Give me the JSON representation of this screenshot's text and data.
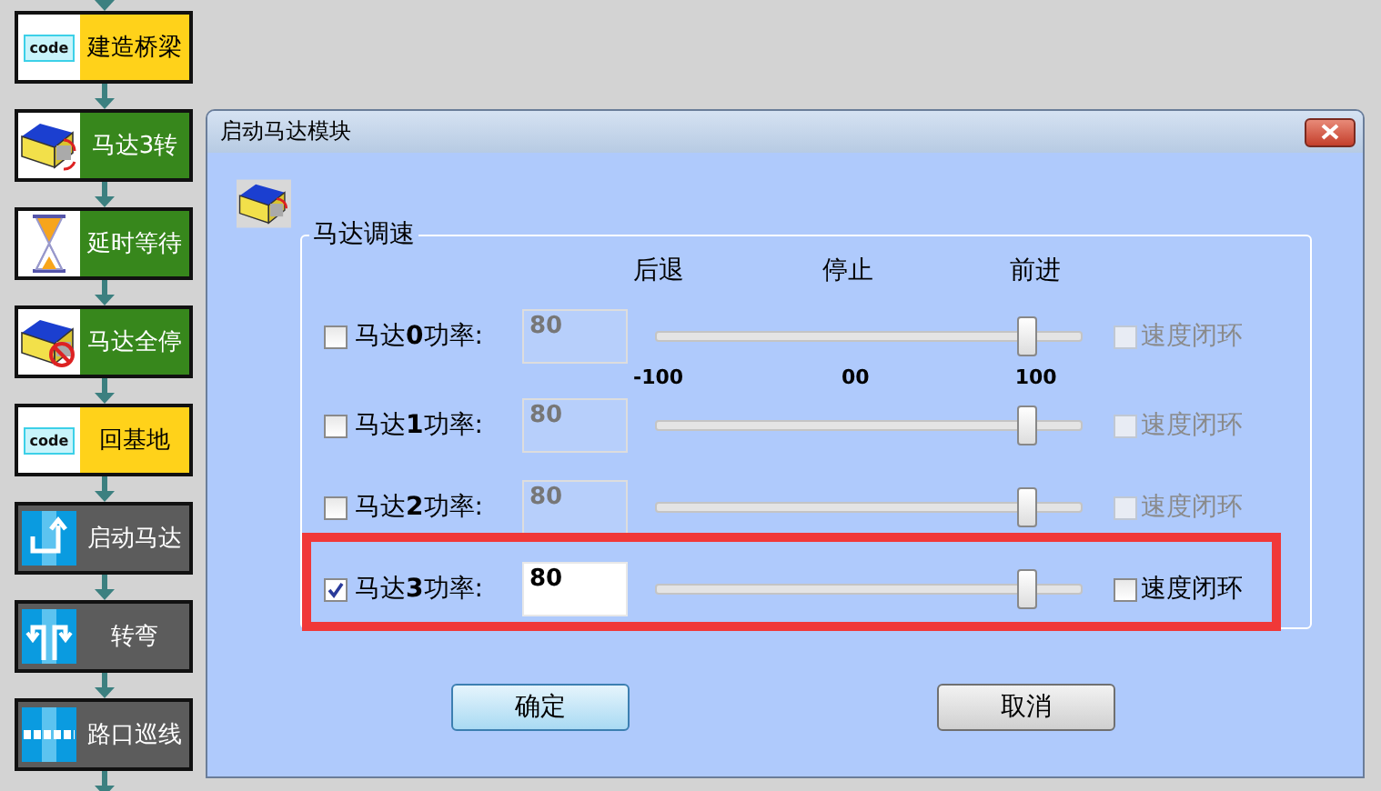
{
  "flow_blocks": [
    {
      "kind": "code",
      "icon_text": "code",
      "label": "建造桥梁",
      "color": "#ffd21a"
    },
    {
      "kind": "motor",
      "label": "马达3转",
      "color": "#37871c"
    },
    {
      "kind": "timer",
      "label": "延时等待",
      "color": "#37871c"
    },
    {
      "kind": "motor-stop",
      "label": "马达全停",
      "color": "#37871c"
    },
    {
      "kind": "code",
      "icon_text": "code",
      "label": "回基地",
      "color": "#ffd21a"
    },
    {
      "kind": "start",
      "label": "启动马达",
      "color": "#5c5c5c"
    },
    {
      "kind": "turn",
      "label": "转弯",
      "color": "#5c5c5c"
    },
    {
      "kind": "line",
      "label": "路口巡线",
      "color": "#5c5c5c"
    }
  ],
  "dialog": {
    "title": "启动马达模块",
    "group_title": "马达调速",
    "headers": [
      "后退",
      "停止",
      "前进"
    ],
    "scale_labels": [
      "-100",
      "00",
      "100"
    ],
    "motors": [
      {
        "label": "马达**0**功率:",
        "checked": false,
        "value": "80",
        "level": 0.87,
        "closed_loop": {
          "label": "速度闭环",
          "checked": false,
          "disabled": true
        },
        "highlighted": false
      },
      {
        "label": "马达**1**功率:",
        "checked": false,
        "value": "80",
        "level": 0.87,
        "closed_loop": {
          "label": "速度闭环",
          "checked": false,
          "disabled": true
        },
        "highlighted": false
      },
      {
        "label": "马达**2**功率:",
        "checked": false,
        "value": "80",
        "level": 0.87,
        "closed_loop": {
          "label": "速度闭环",
          "checked": false,
          "disabled": true
        },
        "highlighted": false
      },
      {
        "label": "马达**3**功率:",
        "checked": true,
        "value": "80",
        "level": 0.87,
        "closed_loop": {
          "label": "速度闭环",
          "checked": false,
          "disabled": false
        },
        "highlighted": true
      }
    ],
    "buttons": [
      "确定",
      "取消"
    ]
  }
}
